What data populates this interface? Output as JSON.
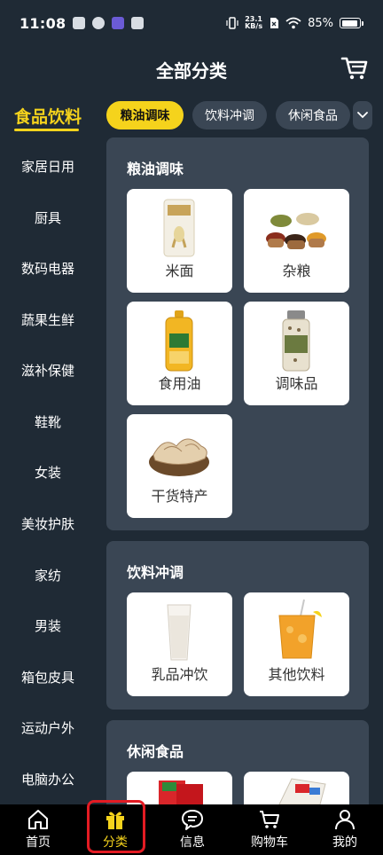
{
  "status_bar": {
    "time": "11:08",
    "net_speed_top": "23.1",
    "net_speed_bottom": "KB/s",
    "battery": "85%"
  },
  "header": {
    "title": "全部分类",
    "cart_icon": "cart-icon"
  },
  "sidebar": {
    "items": [
      {
        "label": "食品饮料",
        "active": true
      },
      {
        "label": "家居日用"
      },
      {
        "label": "厨具"
      },
      {
        "label": "数码电器"
      },
      {
        "label": "蔬果生鲜"
      },
      {
        "label": "滋补保健"
      },
      {
        "label": "鞋靴"
      },
      {
        "label": "女装"
      },
      {
        "label": "美妆护肤"
      },
      {
        "label": "家纺"
      },
      {
        "label": "男装"
      },
      {
        "label": "箱包皮具"
      },
      {
        "label": "运动户外"
      },
      {
        "label": "电脑办公"
      }
    ]
  },
  "chips": {
    "items": [
      {
        "label": "粮油调味",
        "active": true
      },
      {
        "label": "饮料冲调"
      },
      {
        "label": "休闲食品"
      }
    ],
    "more_icon": "chevron-down-icon"
  },
  "sections": [
    {
      "title": "粮油调味",
      "items": [
        {
          "label": "米面",
          "icon": "rice-bag-image"
        },
        {
          "label": "杂粮",
          "icon": "grains-bowls-image"
        },
        {
          "label": "食用油",
          "icon": "oil-bottle-image"
        },
        {
          "label": "调味品",
          "icon": "seasoning-jar-image"
        },
        {
          "label": "干货特产",
          "icon": "dried-mushroom-image"
        }
      ]
    },
    {
      "title": "饮料冲调",
      "items": [
        {
          "label": "乳品冲饮",
          "icon": "milk-glass-image"
        },
        {
          "label": "其他饮料",
          "icon": "juice-glass-image"
        }
      ]
    },
    {
      "title": "休闲食品",
      "items": []
    }
  ],
  "bottom_nav": {
    "items": [
      {
        "label": "首页",
        "icon": "home-icon"
      },
      {
        "label": "分类",
        "icon": "gift-icon",
        "active": true
      },
      {
        "label": "信息",
        "icon": "message-icon"
      },
      {
        "label": "购物车",
        "icon": "cart-icon"
      },
      {
        "label": "我的",
        "icon": "user-icon"
      }
    ]
  },
  "colors": {
    "background": "#1f2a35",
    "panel": "#3a4654",
    "accent": "#f5d31c",
    "highlight": "#e31b23",
    "nav_bg": "#000000"
  }
}
